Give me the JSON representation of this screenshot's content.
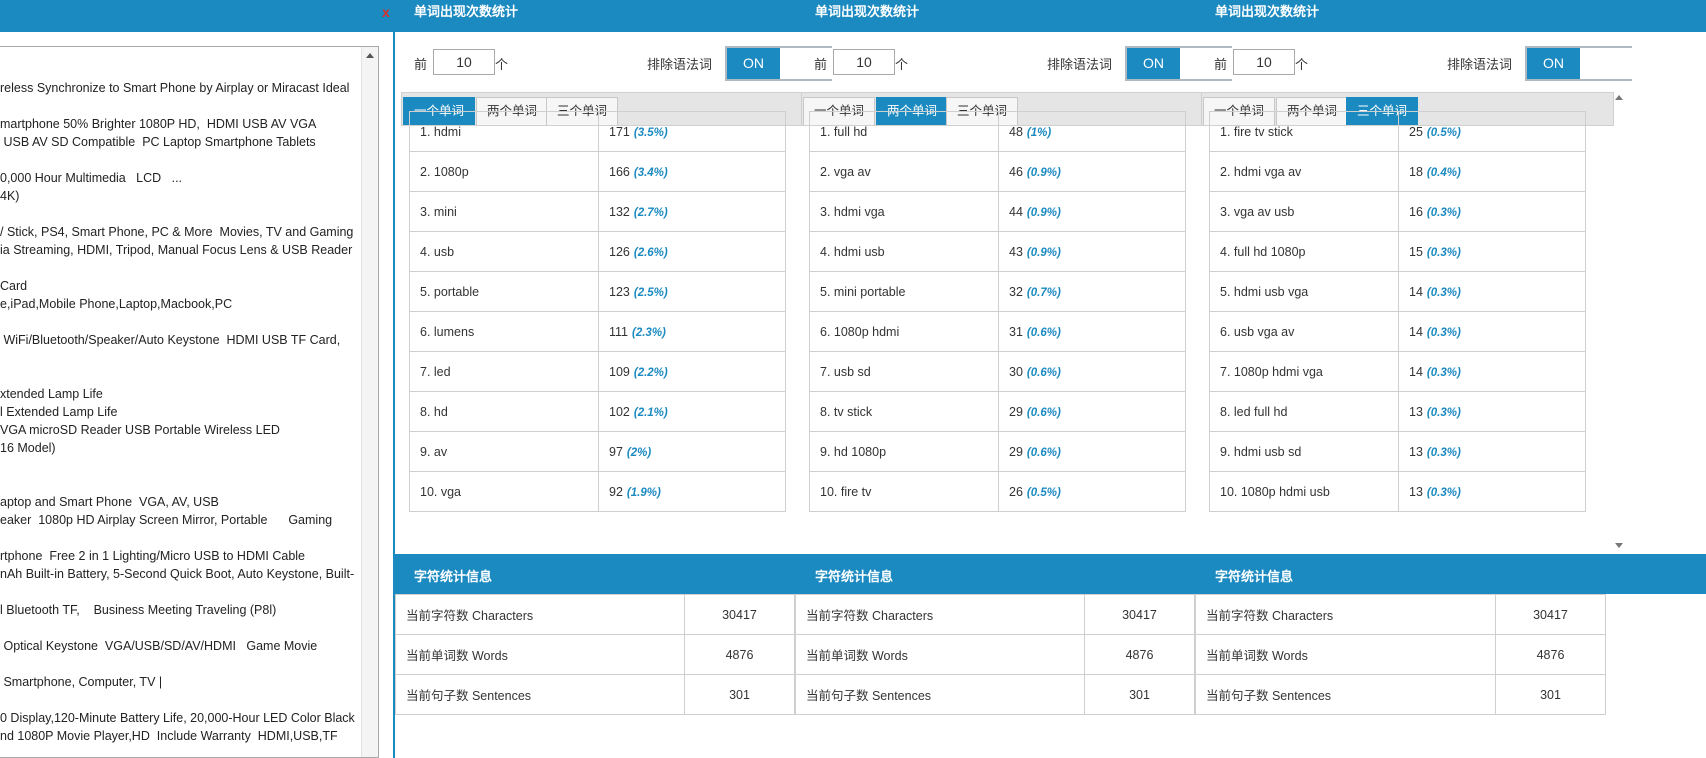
{
  "close_symbol": "x",
  "editor_lines": [
    "reless Synchronize to Smart Phone by Airplay or Miracast Ideal",
    "",
    "martphone 50% Brighter 1080P HD,  HDMI USB AV VGA",
    " USB AV SD Compatible  PC Laptop Smartphone Tablets",
    "",
    "0,000 Hour Multimedia   LCD   ...",
    "4K)",
    "",
    "/ Stick, PS4, Smart Phone, PC & More  Movies, TV and Gaming",
    "ia Streaming, HDMI, Tripod, Manual Focus Lens & USB Reader",
    "",
    "Card",
    "e,iPad,Mobile Phone,Laptop,Macbook,PC",
    "",
    " WiFi/Bluetooth/Speaker/Auto Keystone  HDMI USB TF Card,",
    "",
    "",
    "xtended Lamp Life",
    "l Extended Lamp Life",
    "VGA microSD Reader USB Portable Wireless LED",
    "16 Model)",
    "",
    "",
    "aptop and Smart Phone  VGA, AV, USB",
    "eaker  1080p HD Airplay Screen Mirror, Portable      Gaming",
    "",
    "rtphone  Free 2 in 1 Lighting/Micro USB to HDMI Cable",
    "nAh Built-in Battery, 5-Second Quick Boot, Auto Keystone, Built-",
    "",
    "l Bluetooth TF,    Business Meeting Traveling (P8l)",
    "",
    " Optical Keystone  VGA/USB/SD/AV/HDMI   Game Movie",
    "",
    " Smartphone, Computer, TV |",
    "",
    "0 Display,120-Minute Battery Life, 20,000-Hour LED Color Black",
    "nd 1080P Movie Player,HD  Include Warranty  HDMI,USB,TF"
  ],
  "panels": [
    {
      "title": "单词出现次数统计",
      "prefix_label": "前",
      "count_value": "10",
      "suffix_label": "个",
      "exclude_label": "排除语法词",
      "toggle_label": "ON",
      "tabs": [
        "一个单词",
        "两个单词",
        "三个单词"
      ],
      "active_tab": 0,
      "rows": [
        {
          "word": "1. hdmi",
          "count": "171",
          "pct": "(3.5%)"
        },
        {
          "word": "2. 1080p",
          "count": "166",
          "pct": "(3.4%)"
        },
        {
          "word": "3. mini",
          "count": "132",
          "pct": "(2.7%)"
        },
        {
          "word": "4. usb",
          "count": "126",
          "pct": "(2.6%)"
        },
        {
          "word": "5. portable",
          "count": "123",
          "pct": "(2.5%)"
        },
        {
          "word": "6. lumens",
          "count": "111",
          "pct": "(2.3%)"
        },
        {
          "word": "7. led",
          "count": "109",
          "pct": "(2.2%)"
        },
        {
          "word": "8. hd",
          "count": "102",
          "pct": "(2.1%)"
        },
        {
          "word": "9. av",
          "count": "97",
          "pct": "(2%)"
        },
        {
          "word": "10. vga",
          "count": "92",
          "pct": "(1.9%)"
        }
      ]
    },
    {
      "title": "单词出现次数统计",
      "prefix_label": "前",
      "count_value": "10",
      "suffix_label": "个",
      "exclude_label": "排除语法词",
      "toggle_label": "ON",
      "tabs": [
        "一个单词",
        "两个单词",
        "三个单词"
      ],
      "active_tab": 1,
      "rows": [
        {
          "word": "1. full hd",
          "count": "48",
          "pct": "(1%)"
        },
        {
          "word": "2. vga av",
          "count": "46",
          "pct": "(0.9%)"
        },
        {
          "word": "3. hdmi vga",
          "count": "44",
          "pct": "(0.9%)"
        },
        {
          "word": "4. hdmi usb",
          "count": "43",
          "pct": "(0.9%)"
        },
        {
          "word": "5. mini portable",
          "count": "32",
          "pct": "(0.7%)"
        },
        {
          "word": "6. 1080p hdmi",
          "count": "31",
          "pct": "(0.6%)"
        },
        {
          "word": "7. usb sd",
          "count": "30",
          "pct": "(0.6%)"
        },
        {
          "word": "8. tv stick",
          "count": "29",
          "pct": "(0.6%)"
        },
        {
          "word": "9. hd 1080p",
          "count": "29",
          "pct": "(0.6%)"
        },
        {
          "word": "10. fire tv",
          "count": "26",
          "pct": "(0.5%)"
        }
      ]
    },
    {
      "title": "单词出现次数统计",
      "prefix_label": "前",
      "count_value": "10",
      "suffix_label": "个",
      "exclude_label": "排除语法词",
      "toggle_label": "ON",
      "tabs": [
        "一个单词",
        "两个单词",
        "三个单词"
      ],
      "active_tab": 2,
      "rows": [
        {
          "word": "1. fire tv stick",
          "count": "25",
          "pct": "(0.5%)"
        },
        {
          "word": "2. hdmi vga av",
          "count": "18",
          "pct": "(0.4%)"
        },
        {
          "word": "3. vga av usb",
          "count": "16",
          "pct": "(0.3%)"
        },
        {
          "word": "4. full hd 1080p",
          "count": "15",
          "pct": "(0.3%)"
        },
        {
          "word": "5. hdmi usb vga",
          "count": "14",
          "pct": "(0.3%)"
        },
        {
          "word": "6. usb vga av",
          "count": "14",
          "pct": "(0.3%)"
        },
        {
          "word": "7. 1080p hdmi vga",
          "count": "14",
          "pct": "(0.3%)"
        },
        {
          "word": "8. led full hd",
          "count": "13",
          "pct": "(0.3%)"
        },
        {
          "word": "9. hdmi usb sd",
          "count": "13",
          "pct": "(0.3%)"
        },
        {
          "word": "10. 1080p hdmi usb",
          "count": "13",
          "pct": "(0.3%)"
        }
      ]
    }
  ],
  "char_stats": {
    "title": "字符统计信息",
    "rows": [
      {
        "label": "当前字符数 Characters",
        "value": "30417"
      },
      {
        "label": "当前单词数 Words",
        "value": "4876"
      },
      {
        "label": "当前句子数 Sentences",
        "value": "301"
      }
    ]
  },
  "colors": {
    "accent": "#1b8ac0",
    "close": "#d9302c"
  }
}
